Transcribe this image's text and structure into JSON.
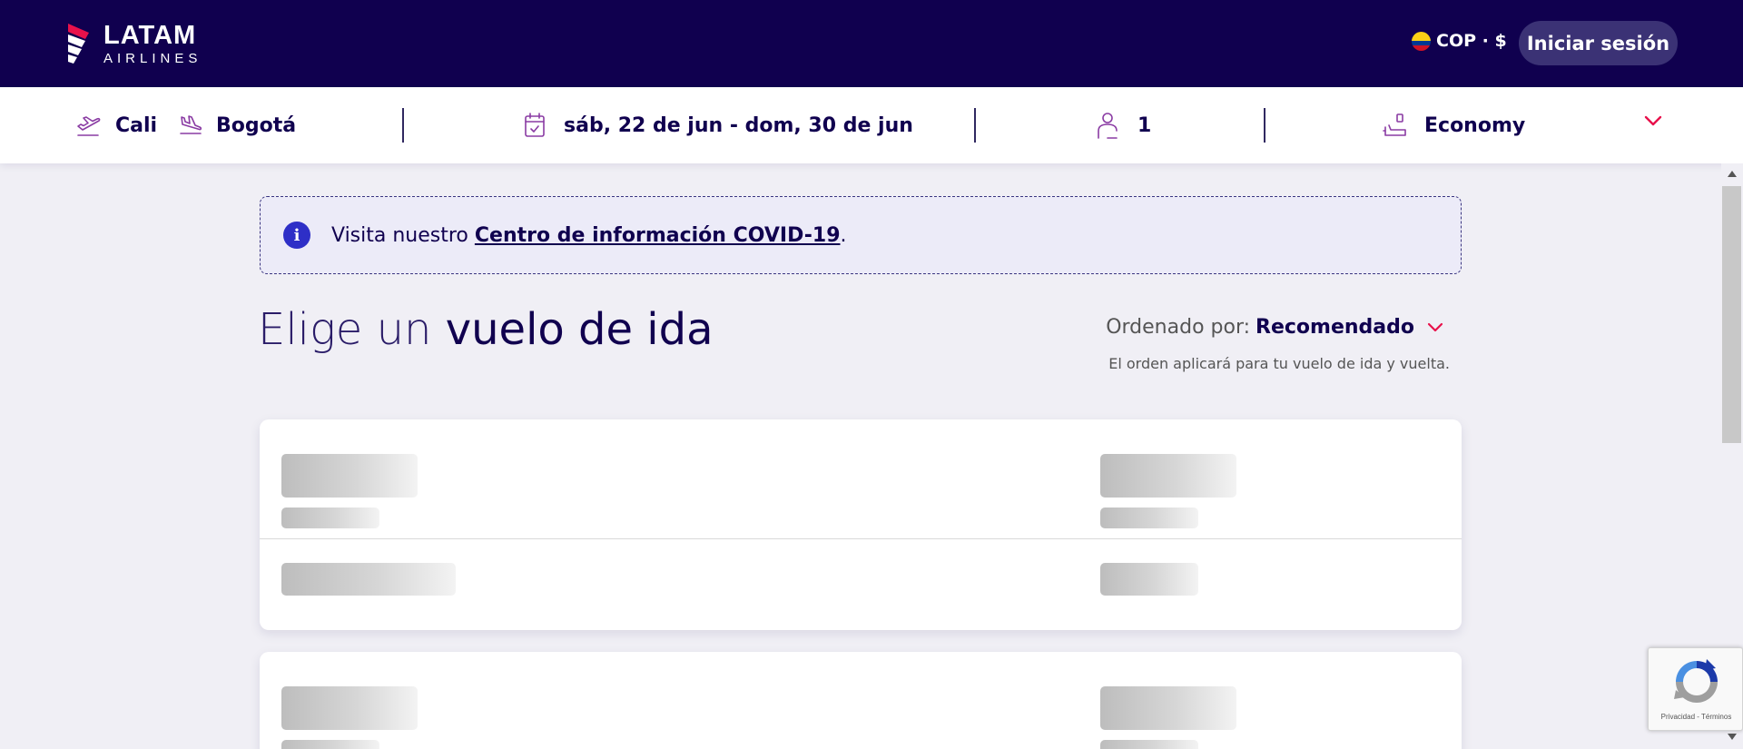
{
  "header": {
    "logo_main": "LATAM",
    "logo_sub": "AIRLINES",
    "currency_label": "COP · $",
    "login_label": "Iniciar sesión",
    "background_color": "#10004f"
  },
  "search": {
    "origin": "Cali",
    "destination": "Bogotá",
    "dates": "sáb, 22 de jun - dom, 30 de jun",
    "passengers": "1",
    "cabin": "Economy",
    "icons": [
      "plane-takeoff-icon",
      "plane-landing-icon",
      "calendar-icon",
      "person-icon",
      "seat-icon",
      "chevron-down-icon"
    ]
  },
  "banner": {
    "prefix": "Visita nuestro ",
    "link": "Centro de información COVID-19",
    "suffix": "."
  },
  "main": {
    "title_light": "Elige un ",
    "title_bold": "vuelo de ida",
    "sort_label": "Ordenado por:",
    "sort_value": "Recomendado",
    "sort_note": "El orden aplicará para tu vuelo de ida y vuelta."
  },
  "recaptcha": {
    "footer": "Privacidad - Términos"
  },
  "colors": {
    "accent": "#e8114b",
    "brand_navy": "#10004f",
    "info_blue": "#2e2fc7"
  }
}
